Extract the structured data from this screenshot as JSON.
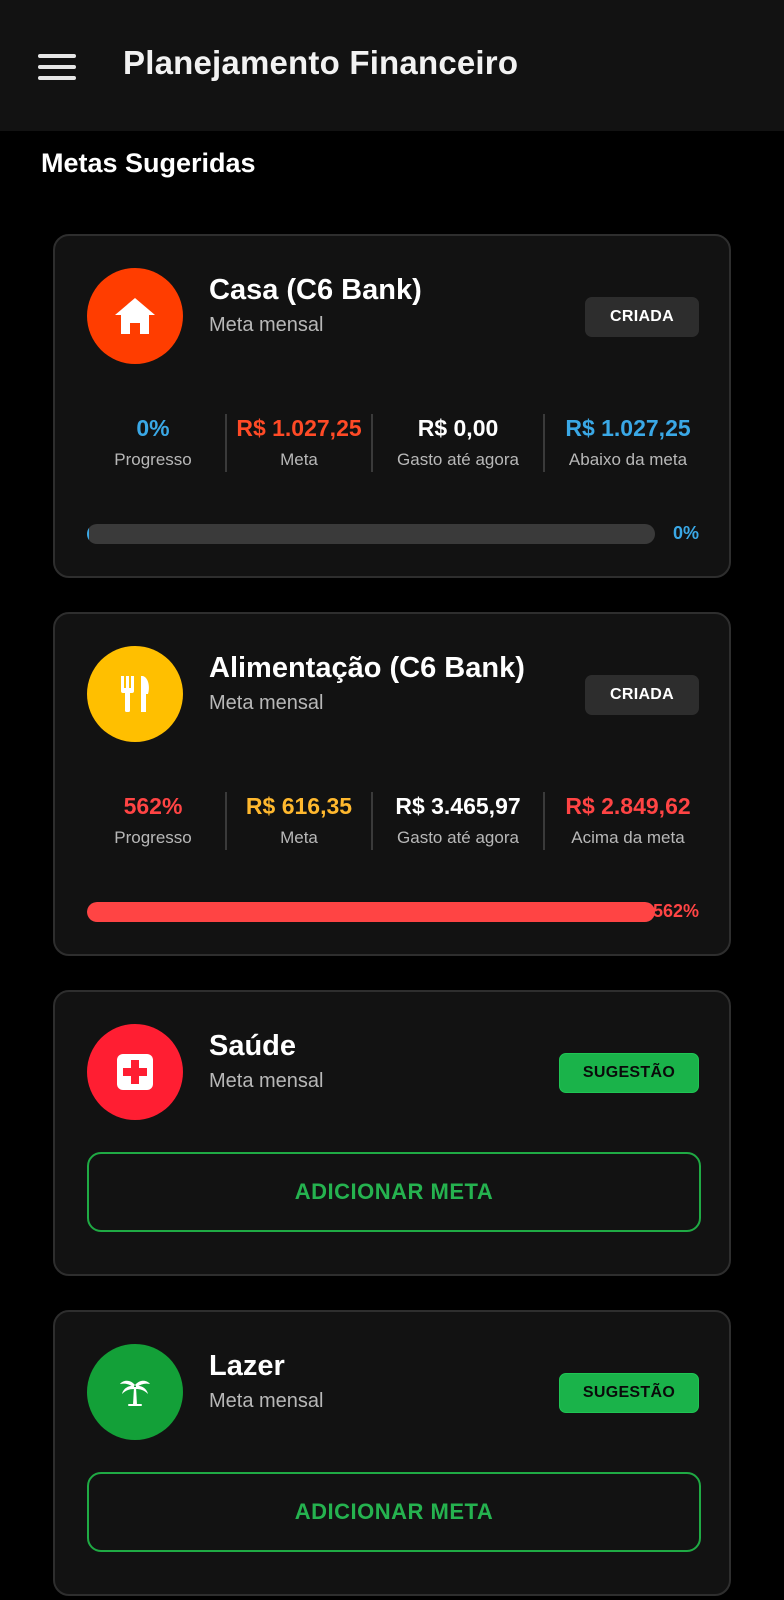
{
  "appbar": {
    "title": "Planejamento Financeiro"
  },
  "section_title": "Metas Sugeridas",
  "colors": {
    "blue": "#3aa8e6",
    "red": "#ff4444",
    "orange": "#ff4a26",
    "yellow": "#ffb82e",
    "green": "#1ab34a",
    "white": "#ffffff"
  },
  "goals": [
    {
      "name": "Casa (C6 Bank)",
      "subtitle": "Meta mensal",
      "icon": "house-icon",
      "icon_color": "#ff3d00",
      "badge": "CRIADA",
      "stats": [
        {
          "value": "0%",
          "label": "Progresso",
          "color": "#3aa8e6"
        },
        {
          "value": "R$ 1.027,25",
          "label": "Meta",
          "color": "#ff4a26"
        },
        {
          "value": "R$ 0,00",
          "label": "Gasto até agora",
          "color": "#ffffff"
        },
        {
          "value": "R$ 1.027,25",
          "label": "Abaixo da meta",
          "color": "#3aa8e6"
        }
      ],
      "progress": {
        "fraction": 0.0,
        "label": "0%",
        "color": "#3aa8e6"
      }
    },
    {
      "name": "Alimentação (C6 Bank)",
      "subtitle": "Meta mensal",
      "icon": "fork-knife-icon",
      "icon_color": "#ffbf00",
      "badge": "CRIADA",
      "stats": [
        {
          "value": "562%",
          "label": "Progresso",
          "color": "#ff4444"
        },
        {
          "value": "R$ 616,35",
          "label": "Meta",
          "color": "#ffb82e"
        },
        {
          "value": "R$ 3.465,97",
          "label": "Gasto até agora",
          "color": "#ffffff"
        },
        {
          "value": "R$ 2.849,62",
          "label": "Acima da meta",
          "color": "#ff4444"
        }
      ],
      "progress": {
        "fraction": 1.0,
        "label": "562%",
        "color": "#ff4444"
      }
    },
    {
      "name": "Saúde",
      "subtitle": "Meta mensal",
      "icon": "medical-cross-icon",
      "icon_color": "#ff1e32",
      "badge": "SUGESTÃO",
      "button": "ADICIONAR META"
    },
    {
      "name": "Lazer",
      "subtitle": "Meta mensal",
      "icon": "palm-tree-icon",
      "icon_color": "#13a038",
      "badge": "SUGESTÃO",
      "button": "ADICIONAR META"
    }
  ]
}
